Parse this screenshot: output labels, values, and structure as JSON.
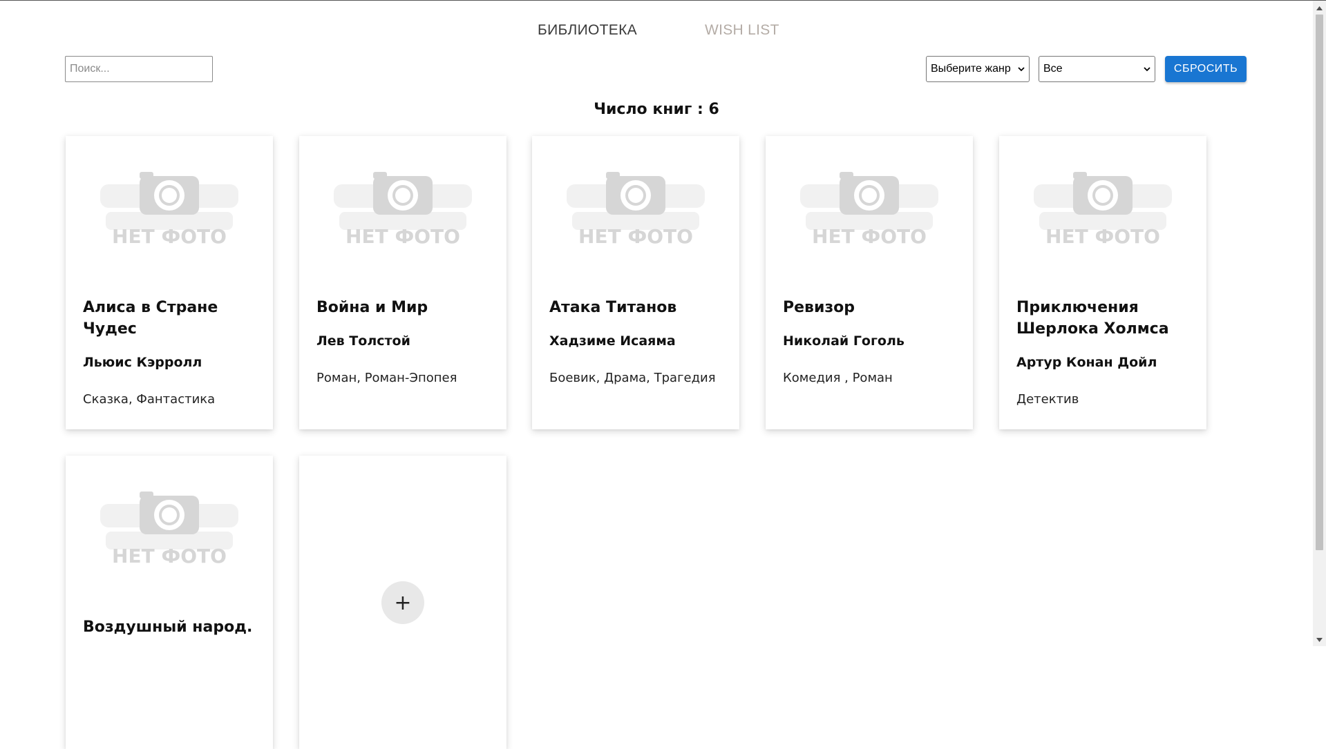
{
  "nav": {
    "library_tab": "БИБЛИОТЕКА",
    "wishlist_tab": "WISH LIST"
  },
  "search": {
    "placeholder": "Поиск..."
  },
  "filters": {
    "genre_select": "Выберите жанр",
    "status_select": "Все",
    "reset_button": "СБРОСИТЬ"
  },
  "book_count": "Число книг : 6",
  "no_photo_text": "НЕТ ФОТО",
  "books": [
    {
      "title": "Алиса в Стране Чудес",
      "author": "Льюис Кэрролл",
      "genres": "Сказка, Фантастика"
    },
    {
      "title": "Война и Мир",
      "author": "Лев Толстой",
      "genres": "Роман, Роман-Эпопея"
    },
    {
      "title": "Атака Титанов",
      "author": "Хадзиме Исаяма",
      "genres": "Боевик, Драма, Трагедия"
    },
    {
      "title": "Ревизор",
      "author": "Николай Гоголь",
      "genres": "Комедия , Роман"
    },
    {
      "title": "Приключения Шерлока Холмса",
      "author": "Артур Конан Дойл",
      "genres": "Детектив"
    },
    {
      "title": "Воздушный народ.",
      "author": "",
      "genres": ""
    }
  ],
  "add_button": "+",
  "colors": {
    "accent": "#1976d2",
    "nav_inactive": "#b4aca6",
    "placeholder_gray": "#d6d6d6"
  },
  "icons": {
    "photo_placeholder": "camera-icon",
    "select_arrow": "chevron-down-icon",
    "add": "plus-icon"
  }
}
